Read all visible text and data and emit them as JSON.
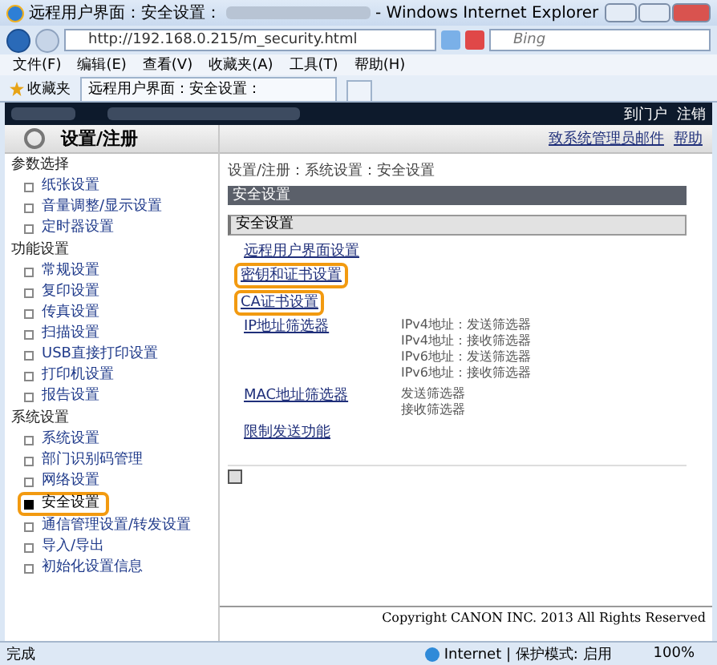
{
  "window": {
    "title_prefix": "远程用户界面：安全设置：",
    "title_suffix": "- Windows Internet Explorer"
  },
  "address": {
    "url": "http://192.168.0.215/m_security.html"
  },
  "search": {
    "placeholder": "Bing"
  },
  "menu": [
    "文件(F)",
    "编辑(E)",
    "查看(V)",
    "收藏夹(A)",
    "工具(T)",
    "帮助(H)"
  ],
  "favorites": {
    "label": "收藏夹",
    "tab": "远程用户界面：安全设置："
  },
  "header_links": [
    "到门户",
    "注销"
  ],
  "page_title": "设置/注册",
  "top_links": [
    "致系统管理员邮件",
    "帮助"
  ],
  "sidebar": [
    {
      "title": "参数选择",
      "items": [
        {
          "label": "纸张设置",
          "selected": false
        },
        {
          "label": "音量调整/显示设置",
          "selected": false
        },
        {
          "label": "定时器设置",
          "selected": false
        }
      ]
    },
    {
      "title": "功能设置",
      "items": [
        {
          "label": "常规设置",
          "selected": false
        },
        {
          "label": "复印设置",
          "selected": false
        },
        {
          "label": "传真设置",
          "selected": false
        },
        {
          "label": "扫描设置",
          "selected": false
        },
        {
          "label": "USB直接打印设置",
          "selected": false
        },
        {
          "label": "打印机设置",
          "selected": false
        },
        {
          "label": "报告设置",
          "selected": false
        }
      ]
    },
    {
      "title": "系统设置",
      "items": [
        {
          "label": "系统设置",
          "selected": false
        },
        {
          "label": "部门识别码管理",
          "selected": false
        },
        {
          "label": "网络设置",
          "selected": false
        },
        {
          "label": "安全设置",
          "selected": true
        },
        {
          "label": "通信管理设置/转发设置",
          "selected": false
        },
        {
          "label": "导入/导出",
          "selected": false
        },
        {
          "label": "初始化设置信息",
          "selected": false
        }
      ]
    }
  ],
  "breadcrumb": "设置/注册：系统设置：安全设置",
  "heading": "安全设置",
  "section": "安全设置",
  "links": [
    {
      "label": "远程用户界面设置",
      "highlighted": false
    },
    {
      "label": "密钥和证书设置",
      "highlighted": true
    },
    {
      "label": "CA证书设置",
      "highlighted": true
    },
    {
      "label": "IP地址筛选器",
      "highlighted": false,
      "details": [
        "IPv4地址：发送筛选器",
        "IPv4地址：接收筛选器",
        "IPv6地址：发送筛选器",
        "IPv6地址：接收筛选器"
      ]
    },
    {
      "label": "MAC地址筛选器",
      "highlighted": false,
      "details": [
        "发送筛选器",
        "接收筛选器"
      ]
    },
    {
      "label": "限制发送功能",
      "highlighted": false
    }
  ],
  "copyright": "Copyright CANON INC. 2013 All Rights Reserved",
  "status": {
    "text": "完成",
    "zone": "Internet | 保护模式: 启用",
    "zoom": "100%"
  }
}
